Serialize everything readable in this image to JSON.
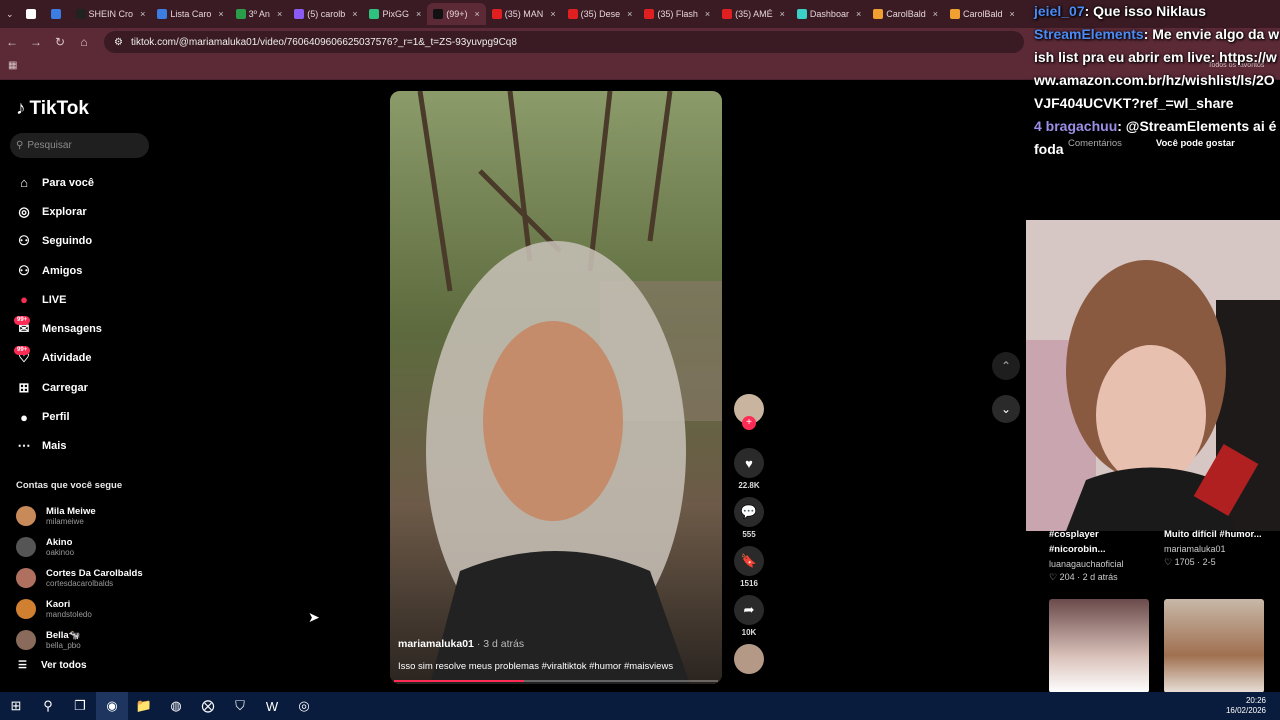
{
  "tabs": [
    {
      "label": "",
      "color": "#ffffff"
    },
    {
      "label": "",
      "color": "#3b7de0"
    },
    {
      "label": "SHEIN Cro",
      "color": "#222222"
    },
    {
      "label": "Lista Caro",
      "color": "#3b7de0"
    },
    {
      "label": "3º An",
      "color": "#2a9d4a"
    },
    {
      "label": "(5) carolb",
      "color": "#8a5cf5"
    },
    {
      "label": "PixGG",
      "color": "#2ec27e"
    },
    {
      "label": "(99+)",
      "color": "#111111",
      "active": true
    },
    {
      "label": "(35) MAN",
      "color": "#e02020"
    },
    {
      "label": "(35) Dese",
      "color": "#e02020"
    },
    {
      "label": "(35) Flash",
      "color": "#e02020"
    },
    {
      "label": "(35) AMÉ",
      "color": "#e02020"
    },
    {
      "label": "Dashboar",
      "color": "#3bd1c8"
    },
    {
      "label": "CarolBald",
      "color": "#f0a030"
    },
    {
      "label": "CarolBald",
      "color": "#f0a030"
    }
  ],
  "address": {
    "url": "tiktok.com/@mariamaluka01/video/7606409606625037576?_r=1&_t=ZS-93yuvpg9Cq8"
  },
  "bookmarks": {
    "all_favorites": "Todos os favoritos"
  },
  "sidebar": {
    "logo": "TikTok",
    "search_placeholder": "Pesquisar",
    "nav": [
      {
        "label": "Para você",
        "icon": "home-icon"
      },
      {
        "label": "Explorar",
        "icon": "compass-icon"
      },
      {
        "label": "Seguindo",
        "icon": "following-icon"
      },
      {
        "label": "Amigos",
        "icon": "friends-icon"
      },
      {
        "label": "LIVE",
        "icon": "live-icon"
      },
      {
        "label": "Mensagens",
        "icon": "messages-icon",
        "badge": "99+"
      },
      {
        "label": "Atividade",
        "icon": "activity-icon",
        "badge": "99+"
      },
      {
        "label": "Carregar",
        "icon": "upload-icon"
      },
      {
        "label": "Perfil",
        "icon": "profile-icon"
      },
      {
        "label": "Mais",
        "icon": "more-icon"
      }
    ],
    "following_title": "Contas que você segue",
    "following": [
      {
        "name": "Mila Meiwe",
        "handle": "milameiwe",
        "color": "#c98a5a"
      },
      {
        "name": "Akino",
        "handle": "oakinoo",
        "color": "#555555"
      },
      {
        "name": "Cortes Da Carolbalds",
        "handle": "cortesdacarolbalds",
        "color": "#b07060"
      },
      {
        "name": "Kaori",
        "handle": "mandstoledo",
        "color": "#d08030"
      },
      {
        "name": "Bella🐄",
        "handle": "bella_pbo",
        "color": "#8a6a5a"
      }
    ],
    "see_all": "Ver todos"
  },
  "video": {
    "author": "mariamaluka01",
    "time": "· 3 d atrás",
    "caption": "Isso sim resolve meus problemas #viraltiktok #humor #maisviews",
    "progress": 0.4
  },
  "actions": {
    "likes": "22.8K",
    "comments": "555",
    "saves": "1516",
    "shares": "10K"
  },
  "chat": [
    {
      "user": "jeiel_07",
      "text": ": Que isso Niklaus"
    },
    {
      "user": "StreamElements",
      "text": ": Me envie algo da wish list pra eu abrir em live: https://www.amazon.com.br/hz/wishlist/ls/2OVJF404UCVKT?ref_=wl_share"
    },
    {
      "user": "4 bragachuu",
      "text": ": @StreamElements ai é foda"
    }
  ],
  "right_panel": {
    "tab_comments": "Comentários",
    "tab_suggest": "Você pode gostar",
    "cards": [
      {
        "title": "#cosplayer #nicorobin...",
        "user": "luanagauchaoficial",
        "likes": "204",
        "time": "2 d atrás"
      },
      {
        "title": "Muito difícil #humor...",
        "user": "mariamaluka01",
        "likes": "1705",
        "time": "2-5"
      }
    ]
  },
  "taskbar": {
    "time": "20:26",
    "date": "16/02/2026"
  }
}
